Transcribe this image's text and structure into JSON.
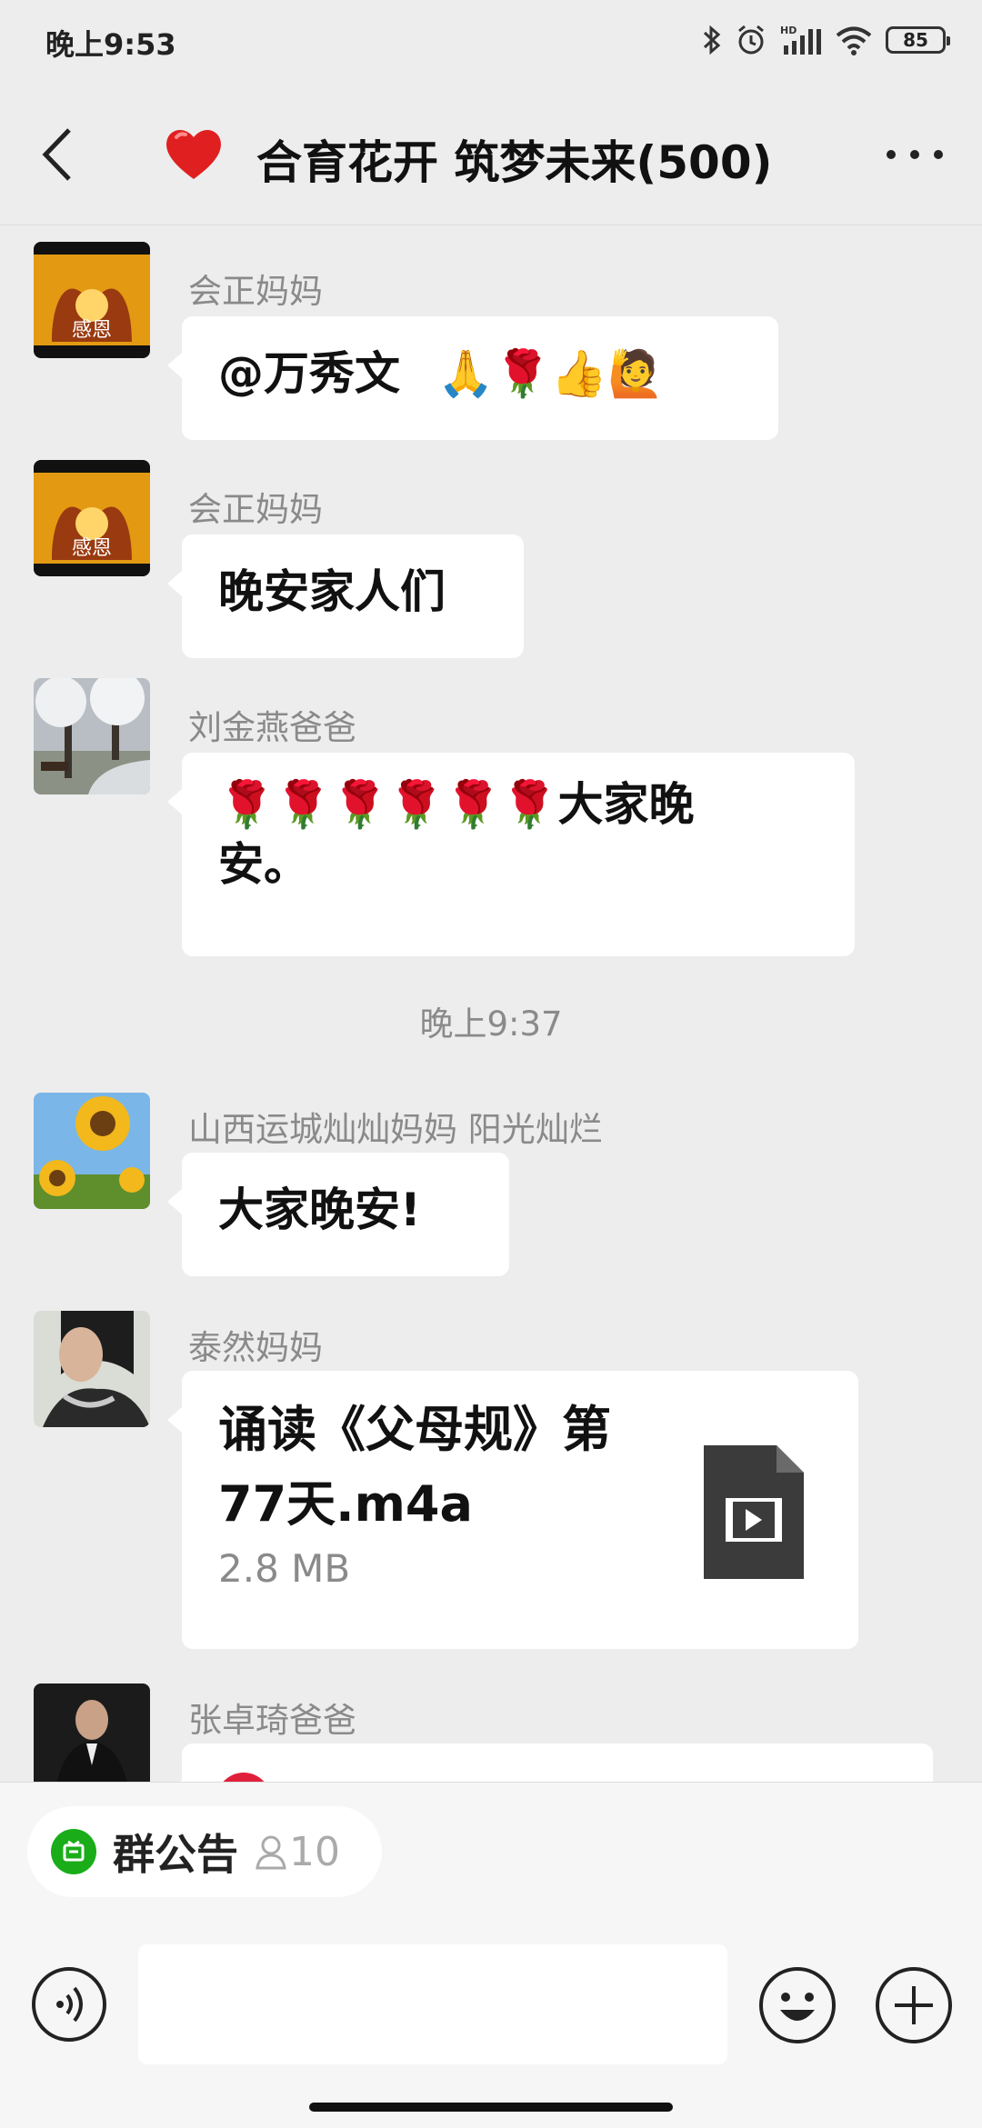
{
  "status": {
    "time": "晚上9:53",
    "hd": "HD",
    "battery": "85"
  },
  "header": {
    "title": "合育花开 筑梦未来(500)",
    "back_icon": "chevron-left-icon",
    "more_icon": "more-icon",
    "title_emoji": "heart-icon"
  },
  "messages": [
    {
      "sender": "会正妈妈",
      "text": "@万秀文",
      "emoji": "🙏🌹👍🙋",
      "avatar_text": "感恩"
    },
    {
      "sender": "会正妈妈",
      "text": "晚安家人们",
      "avatar_text": "感恩"
    },
    {
      "sender": "刘金燕爸爸",
      "text_line1": "🌹🌹🌹🌹🌹🌹大家晚",
      "text_line2": "安。"
    },
    {
      "sender": "山西运城灿灿妈妈 阳光灿烂",
      "text": "大家晚安!"
    },
    {
      "sender": "泰然妈妈",
      "file_line1": "诵读《父母规》第",
      "file_line2": "77天.m4a",
      "file_size": "2.8 MB",
      "file_icon": "video-file-icon"
    },
    {
      "sender": "张卓琦爸爸"
    }
  ],
  "timestamp": "晚上9:37",
  "bottom_bar": {
    "notice_label": "群公告",
    "notice_count": "10"
  },
  "colors": {
    "background": "#ededed",
    "bubble": "#ffffff",
    "notice_green": "#1aad19"
  }
}
